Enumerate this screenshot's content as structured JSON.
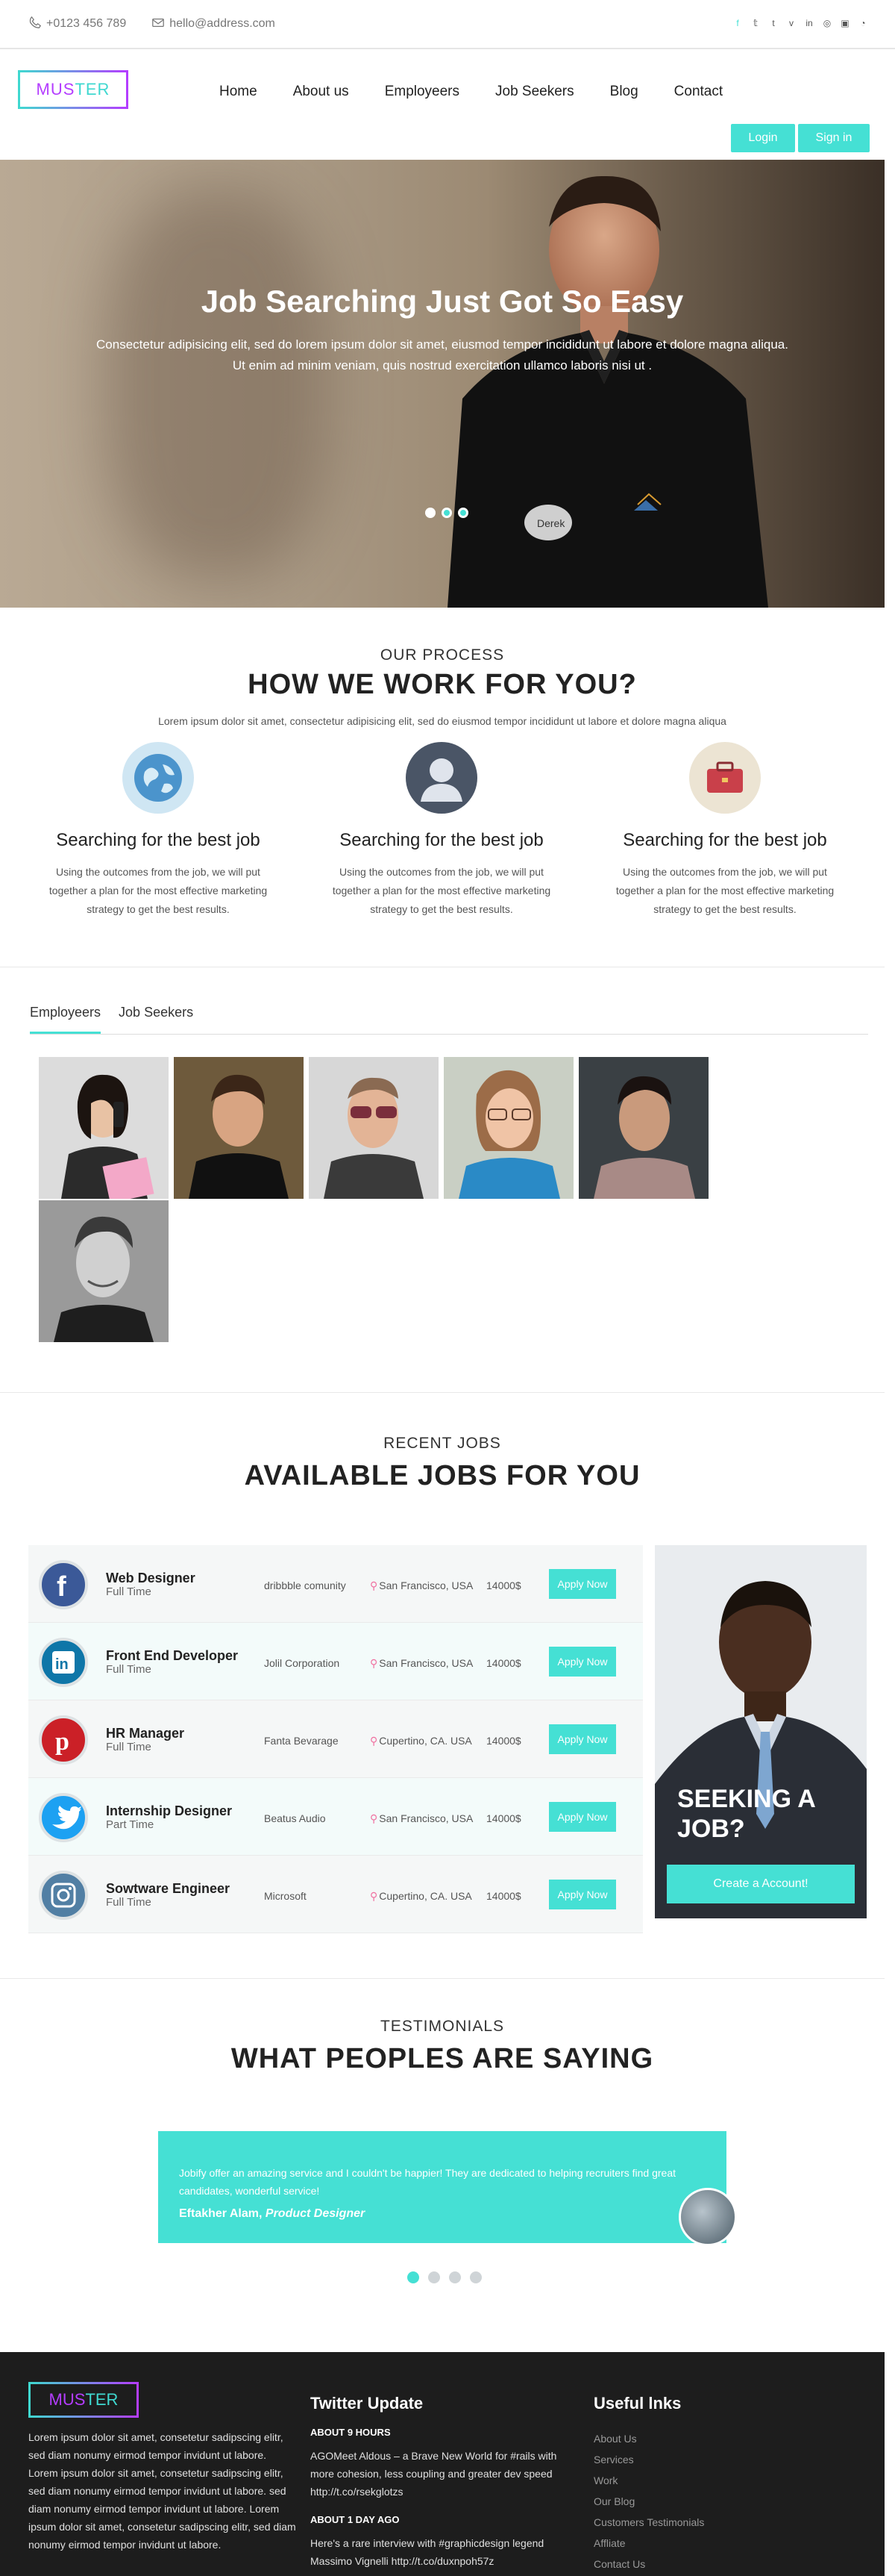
{
  "topbar": {
    "phone": "+0123 456 789",
    "email": "hello@address.com",
    "socials": [
      "facebook-icon",
      "twitter-icon",
      "tumblr-icon",
      "vimeo-icon",
      "linkedin-icon",
      "dribbble-icon",
      "instagram-icon",
      "rss-icon"
    ]
  },
  "brand": {
    "part1": "MUS",
    "part2": "TER"
  },
  "nav": {
    "items": [
      "Home",
      "About us",
      "Employeers",
      "Job Seekers",
      "Blog",
      "Contact"
    ]
  },
  "auth": {
    "login": "Login",
    "signin": "Sign in"
  },
  "hero": {
    "title": "Job Searching Just Got So Easy",
    "subtitle": "Consectetur adipisicing elit, sed do lorem ipsum dolor sit amet, eiusmod tempor incididunt ut labore et dolore magna aliqua. Ut enim ad minim veniam, quis nostrud exercitation ullamco laboris nisi ut ."
  },
  "process": {
    "eyebrow": "OUR PROCESS",
    "title": "HOW WE WORK FOR YOU?",
    "lead": "Lorem ipsum dolor sit amet, consectetur adipisicing elit, sed do eiusmod tempor incididunt ut labore et dolore magna aliqua",
    "features": [
      {
        "title": "Searching for the best job",
        "text": "Using the outcomes from the job, we will put together a plan for the most effective marketing strategy to get the best results."
      },
      {
        "title": "Searching for the best job",
        "text": "Using the outcomes from the job, we will put together a plan for the most effective marketing strategy to get the best results."
      },
      {
        "title": "Searching for the best job",
        "text": "Using the outcomes from the job, we will put together a plan for the most effective marketing strategy to get the best results."
      }
    ]
  },
  "tabs": {
    "employers": "Employeers",
    "seekers": "Job Seekers"
  },
  "jobs": {
    "eyebrow": "RECENT JOBS",
    "title": "AVAILABLE JOBS FOR YOU",
    "apply_label": "Apply Now",
    "list": [
      {
        "title": "Web Designer",
        "type": "Full Time",
        "company": "dribbble comunity",
        "location": "San Francisco, USA",
        "salary": "14000$",
        "color": "#3b5998",
        "icon": "facebook-icon"
      },
      {
        "title": "Front End Developer",
        "type": "Full Time",
        "company": "Jolil Corporation",
        "location": "San Francisco, USA",
        "salary": "14000$",
        "color": "#0e76a8",
        "icon": "linkedin-icon"
      },
      {
        "title": "HR Manager",
        "type": "Full Time",
        "company": "Fanta Bevarage",
        "location": "Cupertino, CA. USA",
        "salary": "14000$",
        "color": "#cb2027",
        "icon": "pinterest-icon"
      },
      {
        "title": "Internship Designer",
        "type": "Part Time",
        "company": "Beatus Audio",
        "location": "San Francisco, USA",
        "salary": "14000$",
        "color": "#1da1f2",
        "icon": "twitter-icon"
      },
      {
        "title": "Sowtware Engineer",
        "type": "Full Time",
        "company": "Microsoft",
        "location": "Cupertino, CA. USA",
        "salary": "14000$",
        "color": "#517fa4",
        "icon": "instagram-icon"
      }
    ],
    "seeking": {
      "line1": "SEEKING A",
      "line2": "JOB?",
      "button": "Create a Account!"
    }
  },
  "testimonials": {
    "eyebrow": "TESTIMONIALS",
    "title": "WHAT PEOPLES ARE SAYING",
    "quote": "Jobify offer an amazing service and I couldn't be happier! They are dedicated to helping recruiters find great candidates, wonderful service!",
    "author": "Eftakher Alam,",
    "role": "Product Designer"
  },
  "footer": {
    "about": "Lorem ipsum dolor sit amet, consetetur sadipscing elitr, sed diam nonumy eirmod tempor invidunt ut labore. Lorem ipsum dolor sit amet, consetetur sadipscing elitr, sed diam nonumy eirmod tempor invidunt ut labore. sed diam nonumy eirmod tempor invidunt ut labore. Lorem ipsum dolor sit amet, consetetur sadipscing elitr, sed diam nonumy eirmod tempor invidunt ut labore.",
    "twitter_title": "Twitter Update",
    "tweets": [
      {
        "when": "ABOUT 9 HOURS",
        "text": "AGOMeet Aldous – a Brave New World for #rails with more cohesion, less coupling and greater dev speed http://t.co/rsekglotzs"
      },
      {
        "when": "ABOUT 1 DAY AGO",
        "text": "Here's a rare interview with #graphicdesign legend Massimo Vignelli http://t.co/duxnpoh57z"
      }
    ],
    "links_title": "Useful lnks",
    "links": [
      "About Us",
      "Services",
      "Work",
      "Our Blog",
      "Customers Testimonials",
      "Affliate",
      "Contact Us"
    ]
  }
}
